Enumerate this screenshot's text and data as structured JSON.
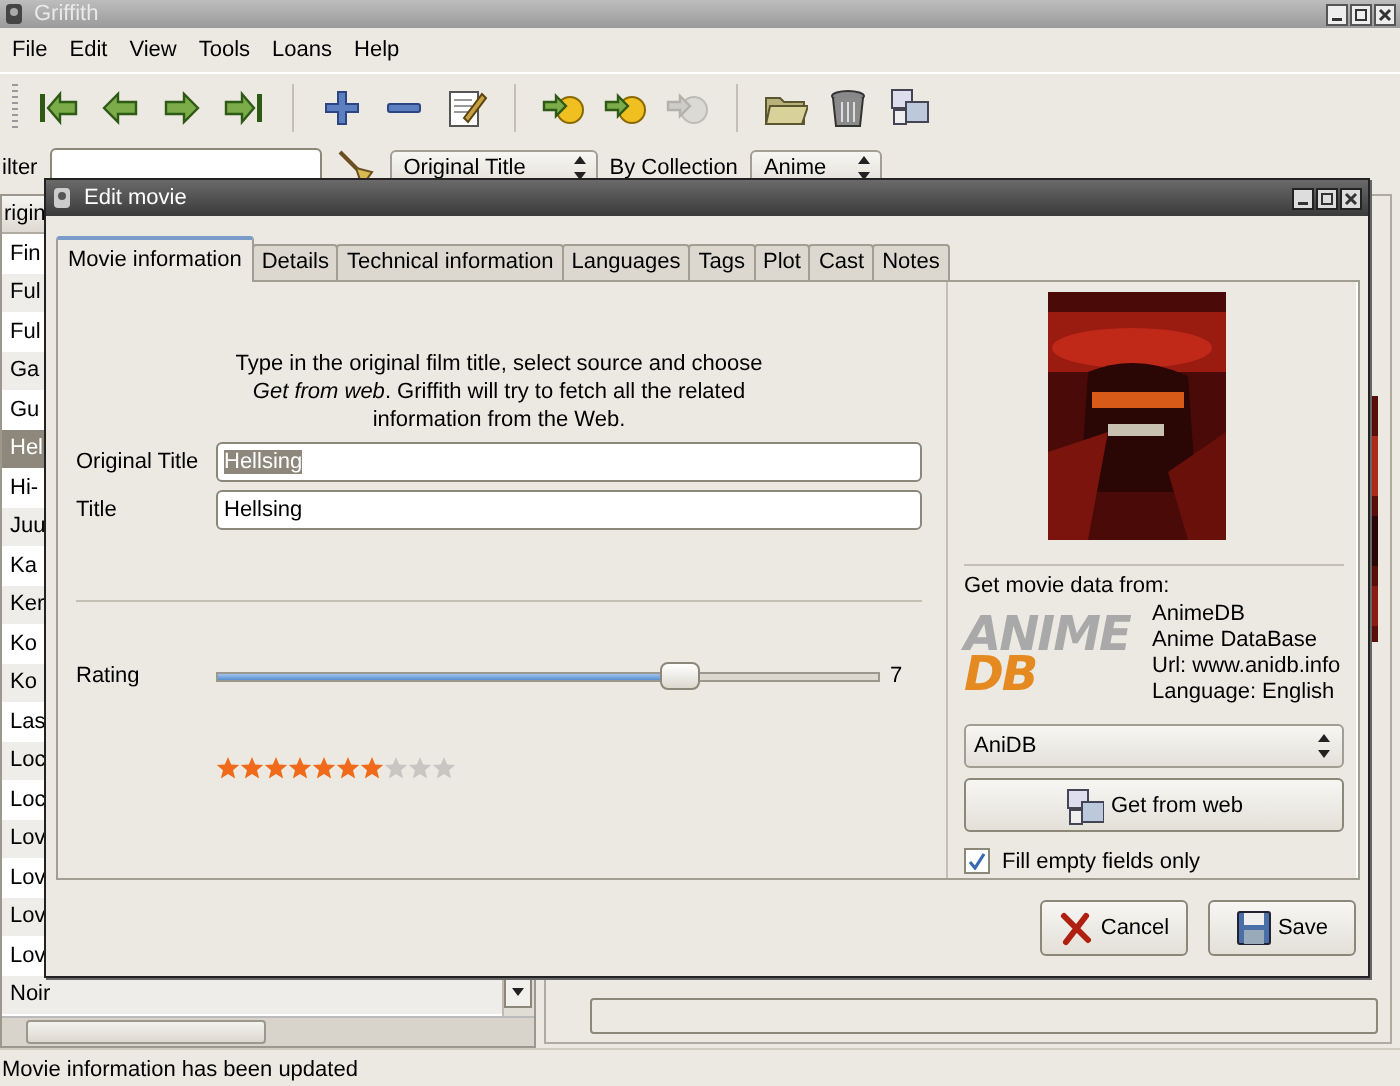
{
  "window": {
    "title": "Griffith"
  },
  "menu": [
    "File",
    "Edit",
    "View",
    "Tools",
    "Loans",
    "Help"
  ],
  "toolbar": [
    {
      "kind": "first",
      "disabled": false
    },
    {
      "kind": "previous",
      "disabled": false
    },
    {
      "kind": "next",
      "disabled": false
    },
    {
      "kind": "last",
      "disabled": false
    },
    {
      "kind": "separator"
    },
    {
      "kind": "add",
      "disabled": false
    },
    {
      "kind": "remove",
      "disabled": false
    },
    {
      "kind": "edit",
      "disabled": false
    },
    {
      "kind": "separator"
    },
    {
      "kind": "web",
      "disabled": false
    },
    {
      "kind": "web",
      "disabled": false
    },
    {
      "kind": "web",
      "disabled": true
    },
    {
      "kind": "separator"
    },
    {
      "kind": "folder",
      "disabled": false
    },
    {
      "kind": "trash",
      "disabled": false
    },
    {
      "kind": "windows",
      "disabled": false
    }
  ],
  "filter": {
    "label": "ilter",
    "sort_by": "Original Title",
    "collection_label": "By Collection",
    "collection": "Anime"
  },
  "list": {
    "header": "rigin",
    "rows": [
      {
        "text": "Fin",
        "selected": false
      },
      {
        "text": "Ful",
        "selected": false
      },
      {
        "text": "Ful",
        "selected": false
      },
      {
        "text": "Ga",
        "selected": false
      },
      {
        "text": "Gu",
        "selected": false
      },
      {
        "text": "Hel",
        "selected": true
      },
      {
        "text": "Hi-",
        "selected": false
      },
      {
        "text": "Juu",
        "selected": false
      },
      {
        "text": "Ka",
        "selected": false
      },
      {
        "text": "Ker",
        "selected": false
      },
      {
        "text": "Ko",
        "selected": false
      },
      {
        "text": "Ko",
        "selected": false
      },
      {
        "text": "Las",
        "selected": false
      },
      {
        "text": "Loc",
        "selected": false
      },
      {
        "text": "Loc",
        "selected": false
      },
      {
        "text": "Lov",
        "selected": false
      },
      {
        "text": "Lov",
        "selected": false
      },
      {
        "text": "Lov",
        "selected": false
      },
      {
        "text": "Lov",
        "selected": false
      },
      {
        "text": "Noir",
        "selected": false
      }
    ]
  },
  "status_bar": "Movie information has been updated",
  "dialog": {
    "title": "Edit movie",
    "tabs": [
      {
        "label": "Movie information",
        "selected": true
      },
      {
        "label": "Details",
        "selected": false
      },
      {
        "label": "Technical information",
        "selected": false
      },
      {
        "label": "Languages",
        "selected": false
      },
      {
        "label": "Tags",
        "selected": false
      },
      {
        "label": "Plot",
        "selected": false
      },
      {
        "label": "Cast",
        "selected": false
      },
      {
        "label": "Notes",
        "selected": false
      }
    ],
    "description": "Type in the original film title, select source and choose *Get from web*. Griffith will try to fetch all the related information from the Web.",
    "fields": [
      {
        "label": "Original Title",
        "value": "Hellsing",
        "text_selected": true
      },
      {
        "label": "Title",
        "value": "Hellsing",
        "text_selected": false
      }
    ],
    "rating": {
      "label": "Rating",
      "level": 0.7,
      "reading": "7",
      "stars": 7
    },
    "source": {
      "heading": "Get movie data from:",
      "logo": {
        "top": "ANIME",
        "bottom": "DB"
      },
      "info": [
        "AnimeDB",
        "Anime DataBase",
        "Url: www.anidb.info",
        "Language: English"
      ],
      "plugin": "AniDB",
      "fetch_button": "Get from web",
      "fill_empty": {
        "label": "Fill empty fields only",
        "checked": true
      }
    },
    "buttons": [
      {
        "kind": "cancel",
        "label": "Cancel"
      },
      {
        "kind": "save",
        "label": "Save"
      }
    ]
  }
}
